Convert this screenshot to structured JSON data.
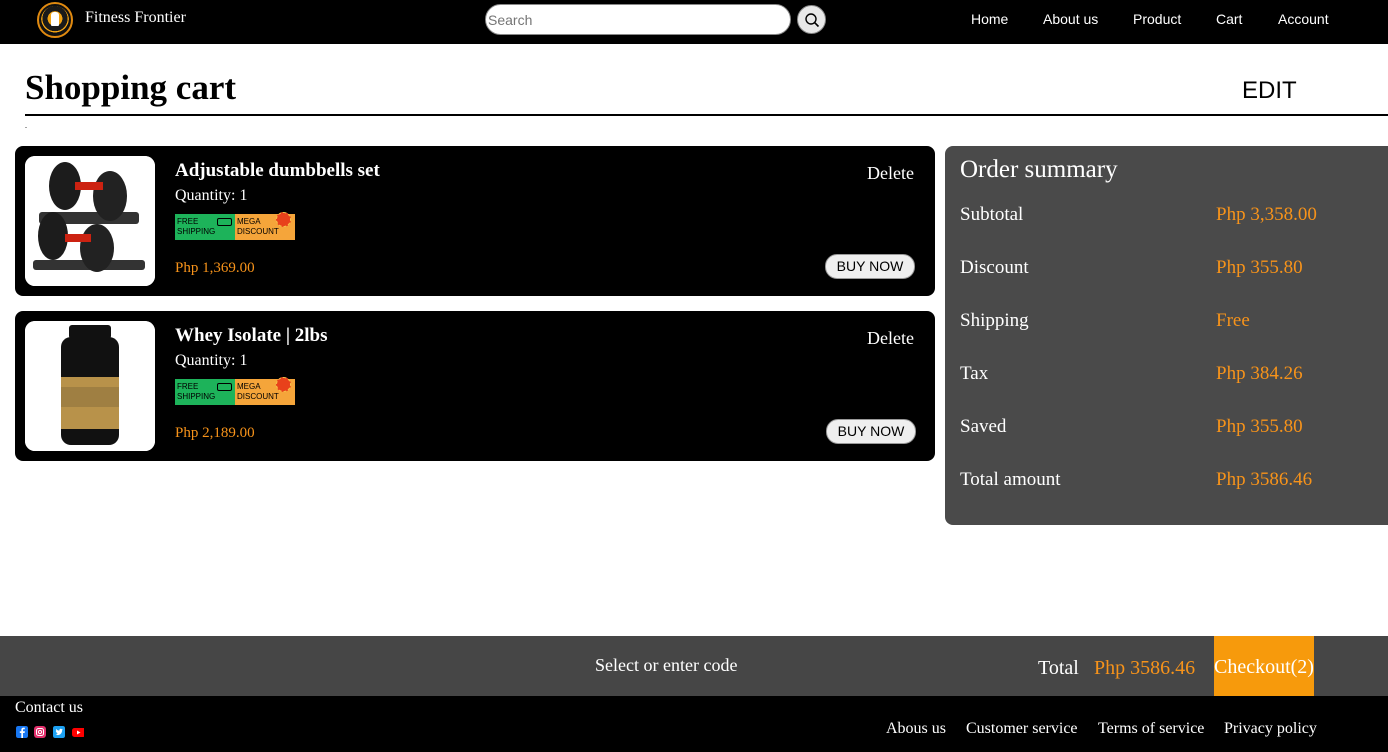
{
  "nav": {
    "brand": "Fitness Frontier",
    "search_placeholder": "Search",
    "links": [
      "Home",
      "About us",
      "Product",
      "Cart",
      "Account"
    ]
  },
  "header": {
    "title": "Shopping cart",
    "edit_label": "EDIT",
    "dot": "."
  },
  "cart": {
    "items": [
      {
        "name": "Adjustable dumbbells set",
        "quantity": "Quantity: 1",
        "badge_free": "FREE\nSHIPPING",
        "badge_mega": "MEGA\nDISCOUNT",
        "price": "Php 1,369.00",
        "delete_label": "Delete",
        "buy_label": "BUY NOW"
      },
      {
        "name": "Whey Isolate | 2lbs",
        "quantity": "Quantity: 1",
        "badge_free": "FREE\nSHIPPING",
        "badge_mega": "MEGA\nDISCOUNT",
        "price": "Php 2,189.00",
        "delete_label": "Delete",
        "buy_label": "BUY NOW"
      }
    ]
  },
  "summary": {
    "title": "Order summary",
    "rows": [
      {
        "label": "Subtotal",
        "value": "Php 3,358.00"
      },
      {
        "label": "Discount",
        "value": "Php 355.80"
      },
      {
        "label": "Shipping",
        "value": "Free"
      },
      {
        "label": "Tax",
        "value": "Php 384.26"
      },
      {
        "label": "Saved",
        "value": "Php 355.80"
      },
      {
        "label": "Total amount",
        "value": "Php 3586.46"
      }
    ]
  },
  "checkout_bar": {
    "promo_label": "Select or enter code",
    "total_label": "Total",
    "total_value": "Php 3586.46",
    "checkout_label": "Checkout(2)"
  },
  "footer": {
    "contact_label": "Contact us",
    "social_icons": [
      "facebook-icon",
      "instagram-icon",
      "twitter-icon",
      "youtube-icon"
    ],
    "links": [
      "Abous us",
      "Customer service",
      "Terms of service",
      "Privacy policy"
    ]
  },
  "colors": {
    "accent": "#f7931a",
    "nav_bg": "#000000",
    "panel_bg": "#4a4a4a",
    "checkout_bg": "#f79a0c"
  }
}
